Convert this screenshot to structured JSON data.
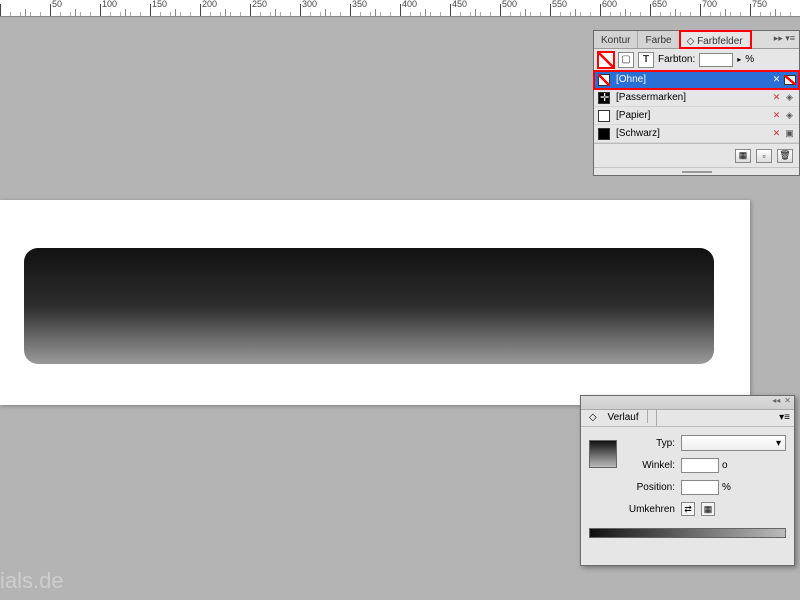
{
  "ruler": {
    "start": 50,
    "step": 50,
    "count": 16
  },
  "swatch_panel": {
    "tabs": [
      "Kontur",
      "Farbe",
      "Farbfelder"
    ],
    "active_tab": 2,
    "tint_label": "Farbton:",
    "tint_unit": "%",
    "swatches": [
      {
        "name": "[Ohne]",
        "type": "none",
        "selected": true
      },
      {
        "name": "[Passermarken]",
        "type": "reg"
      },
      {
        "name": "[Papier]",
        "type": "white"
      },
      {
        "name": "[Schwarz]",
        "type": "black"
      }
    ]
  },
  "verlauf_panel": {
    "title": "Verlauf",
    "fields": {
      "typ_label": "Typ:",
      "winkel_label": "Winkel:",
      "winkel_value": "",
      "winkel_unit": "o",
      "position_label": "Position:",
      "position_value": "",
      "position_unit": "%",
      "umkehren_label": "Umkehren"
    }
  },
  "watermark": "ials.de"
}
